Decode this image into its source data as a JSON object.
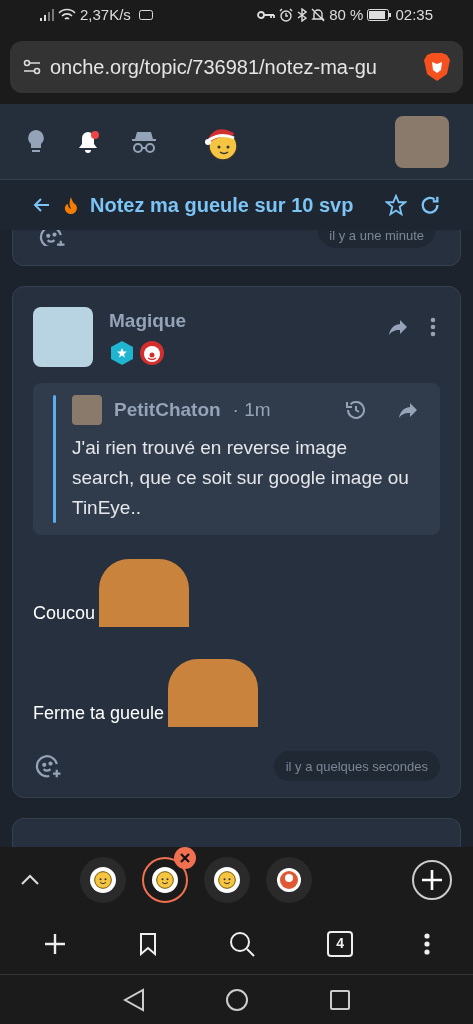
{
  "status_bar": {
    "speed": "2,37K/s",
    "battery": "80 %",
    "time": "02:35"
  },
  "address_bar": {
    "url": "onche.org/topic/736981/notez-ma-gu"
  },
  "topic": {
    "title": "Notez ma gueule sur 10 svp"
  },
  "previous_post": {
    "time": "il y a une minute"
  },
  "post": {
    "author": "Magique",
    "quote": {
      "author": "PetitChaton",
      "age": "· 1m",
      "text": "J'ai rien trouvé en reverse image search, que ce soit sur google image ou TinEye.."
    },
    "lines": [
      {
        "text": "Coucou"
      },
      {
        "text": "Ferme ta gueule"
      }
    ],
    "time": "il y a quelques secondes"
  },
  "tabs": [
    {
      "kind": "site",
      "selected": false
    },
    {
      "kind": "site",
      "selected": true
    },
    {
      "kind": "site",
      "selected": false
    },
    {
      "kind": "search",
      "selected": false
    }
  ],
  "toolbar": {
    "tab_count": "4"
  }
}
